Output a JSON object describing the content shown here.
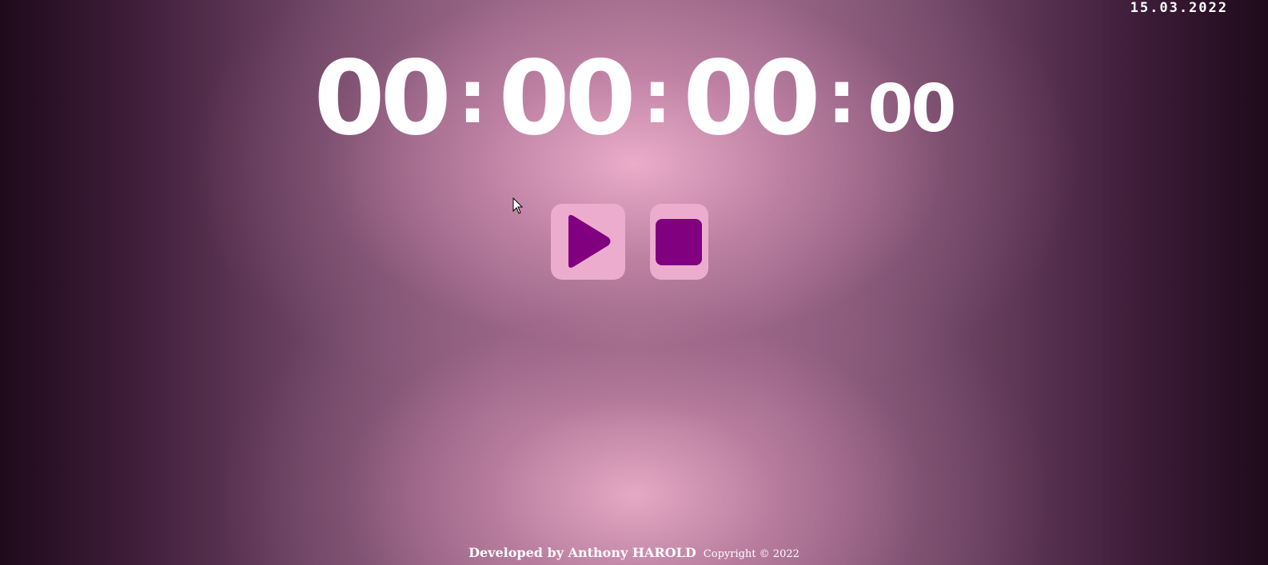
{
  "header": {
    "date": "15.03.2022"
  },
  "timer": {
    "hours": "00",
    "minutes": "00",
    "seconds": "00",
    "centiseconds": "00",
    "separator": ":"
  },
  "controls": {
    "play_icon": "play-icon",
    "stop_icon": "stop-icon",
    "icon_color": "#800080",
    "button_color": "#ecaccd"
  },
  "footer": {
    "developer_text": "Developed by Anthony HAROLD",
    "copyright_text": "Copyright © 2022"
  }
}
